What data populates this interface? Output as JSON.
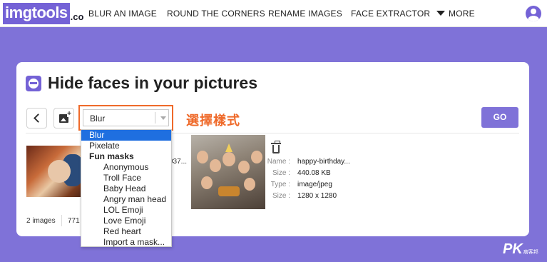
{
  "brand": {
    "logo_text": "imgtools",
    "logo_suffix": ".co"
  },
  "nav": {
    "items": [
      "BLUR AN IMAGE",
      "ROUND THE CORNERS",
      "RENAME IMAGES",
      "FACE EXTRACTOR"
    ],
    "more_label": "MORE"
  },
  "page": {
    "title": "Hide faces in your pictures"
  },
  "toolbar": {
    "style_select_value": "Blur",
    "annotation": "選擇樣式",
    "go_label": "GO"
  },
  "dropdown": {
    "options": [
      {
        "label": "Blur",
        "selected": true,
        "group": false
      },
      {
        "label": "Pixelate",
        "selected": false,
        "group": false
      },
      {
        "label": "Fun masks",
        "selected": false,
        "group": true
      },
      {
        "label": "Anonymous",
        "selected": false,
        "group": false
      },
      {
        "label": "Troll Face",
        "selected": false,
        "group": false
      },
      {
        "label": "Baby Head",
        "selected": false,
        "group": false
      },
      {
        "label": "Angry man head",
        "selected": false,
        "group": false
      },
      {
        "label": "LOL Emoji",
        "selected": false,
        "group": false
      },
      {
        "label": "Love Emoji",
        "selected": false,
        "group": false
      },
      {
        "label": "Red heart",
        "selected": false,
        "group": false
      },
      {
        "label": "Import a mask...",
        "selected": false,
        "group": false
      }
    ]
  },
  "images": {
    "first_name_partial": "937...",
    "second": {
      "name_label": "Name :",
      "name": "happy-birthday...",
      "size_label": "Size :",
      "size": "440.08 KB",
      "type_label": "Type :",
      "type": "image/jpeg",
      "dims_label": "Size :",
      "dims": "1280 x 1280"
    }
  },
  "footer": {
    "count": "2 images",
    "total_partial": "771"
  },
  "watermark": {
    "big": "PK",
    "small": "痞客邦"
  },
  "colors": {
    "accent": "#7f72d8",
    "brand": "#7462d6",
    "highlight": "#ef6a2a",
    "selected": "#1f6fe0"
  }
}
